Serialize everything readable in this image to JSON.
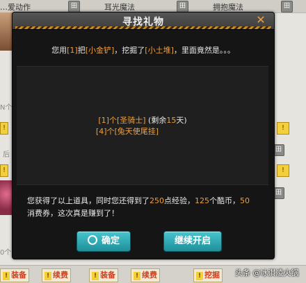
{
  "background": {
    "top_labels": [
      "…爱动作",
      "耳光魔法",
      "拥抱魔法"
    ],
    "left_faint_1": "N个",
    "left_faint_2": "后",
    "left_faint_3": "0个",
    "bottom_buttons": [
      "装备",
      "续费",
      "装备",
      "续费",
      "挖掘"
    ],
    "watermark": "头条 @冰淇凌火锅"
  },
  "dialog": {
    "title": "寻找礼物",
    "close_icon": "close-icon",
    "message": {
      "pre": "您用",
      "qty": "[1]",
      "mid1": "把",
      "tool": "[小金铲]",
      "mid2": "，挖掘了",
      "place": "[小土堆]",
      "post": "，里面竟然是。。。"
    },
    "items": [
      {
        "qty": "[1]",
        "unit": "个",
        "name": "[圣骑士]",
        "note_pre": " (剩余",
        "note_num": "15",
        "note_post": "天)"
      },
      {
        "qty": "[4]",
        "unit": "个",
        "name": "[兔天使尾挂]",
        "note_pre": "",
        "note_num": "",
        "note_post": ""
      }
    ],
    "summary": {
      "p1": "您获得了以上道具，同时您还得到了",
      "exp": "250",
      "p2": "点经验，",
      "coins": "125",
      "p3": "个酷币，",
      "vouchers": "50",
      "p4": "消费券，这次真是赚到了！"
    },
    "buttons": {
      "ok": "确定",
      "continue": "继续开启"
    }
  },
  "colors": {
    "highlight": "#f0a040",
    "button": "#2aa6b1",
    "dialog_bg": "#151515"
  }
}
